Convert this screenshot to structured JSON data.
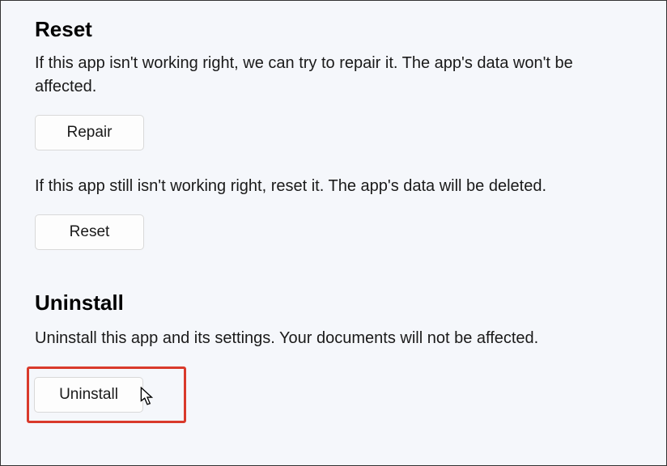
{
  "reset": {
    "heading": "Reset",
    "repairDescription": "If this app isn't working right, we can try to repair it. The app's data won't be affected.",
    "repairLabel": "Repair",
    "resetDescription": "If this app still isn't working right, reset it. The app's data will be deleted.",
    "resetLabel": "Reset"
  },
  "uninstall": {
    "heading": "Uninstall",
    "description": "Uninstall this app and its settings. Your documents will not be affected.",
    "uninstallLabel": "Uninstall"
  }
}
